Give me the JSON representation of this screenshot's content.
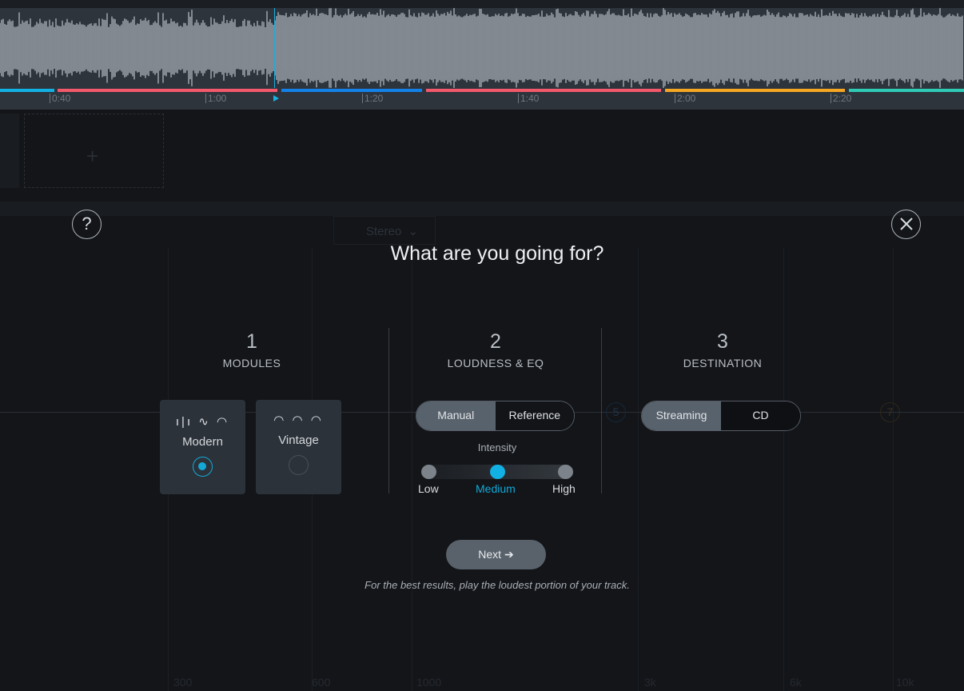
{
  "timeline": {
    "ticks": [
      "0:40",
      "1:00",
      "1:20",
      "1:40",
      "2:00",
      "2:20"
    ],
    "segment_colors": [
      "#12b1e4",
      "#f2596b",
      "#1381e8",
      "#f2596b",
      "#f5a623",
      "#2ecbb6"
    ],
    "playhead_color": "#1ab0e0"
  },
  "background": {
    "channel_mode": "Stereo",
    "freq_labels": [
      "300",
      "600",
      "1000",
      "3k",
      "6k",
      "10k"
    ],
    "node_labels": [
      "5",
      "7"
    ]
  },
  "dialog": {
    "title": "What are you going for?",
    "help_icon": "question-icon",
    "close_icon": "close-icon",
    "steps": [
      {
        "number": "1",
        "label": "MODULES"
      },
      {
        "number": "2",
        "label": "LOUDNESS & EQ"
      },
      {
        "number": "3",
        "label": "DESTINATION"
      }
    ],
    "modules": [
      {
        "label": "Modern",
        "selected": true,
        "icons": [
          "waveform-icon",
          "eq-curve-icon",
          "gauge-icon"
        ]
      },
      {
        "label": "Vintage",
        "selected": false,
        "icons": [
          "vintage-dial-icon",
          "vintage-dial-icon",
          "vintage-dial-icon"
        ]
      }
    ],
    "loudness_mode": {
      "options": [
        "Manual",
        "Reference"
      ],
      "selected": "Manual"
    },
    "intensity": {
      "label": "Intensity",
      "options": [
        "Low",
        "Medium",
        "High"
      ],
      "selected": "Medium"
    },
    "destination": {
      "options": [
        "Streaming",
        "CD"
      ],
      "selected": "Streaming"
    },
    "next_label": "Next",
    "hint": "For the best results, play the loudest portion of your track.",
    "accent": "#12b1e4"
  }
}
